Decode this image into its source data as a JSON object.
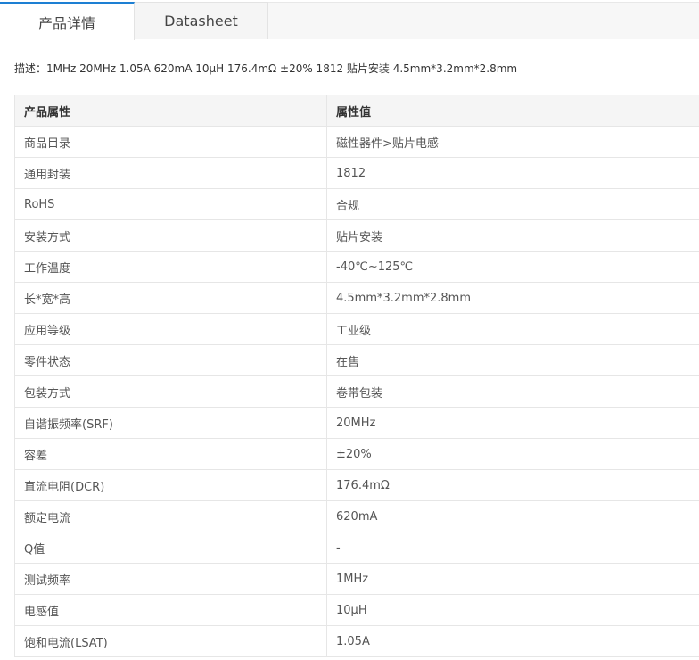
{
  "tabs": [
    {
      "label": "产品详情",
      "active": true
    },
    {
      "label": "Datasheet",
      "active": false
    }
  ],
  "description": "描述：1MHz 20MHz 1.05A 620mA 10μH 176.4mΩ ±20% 1812 贴片安装 4.5mm*3.2mm*2.8mm",
  "table": {
    "headers": [
      "产品属性",
      "属性值"
    ],
    "rows": [
      [
        "商品目录",
        "磁性器件>贴片电感"
      ],
      [
        "通用封装",
        "1812"
      ],
      [
        "RoHS",
        "合规"
      ],
      [
        "安装方式",
        "贴片安装"
      ],
      [
        "工作温度",
        "-40℃~125℃"
      ],
      [
        "长*宽*高",
        "4.5mm*3.2mm*2.8mm"
      ],
      [
        "应用等级",
        "工业级"
      ],
      [
        "零件状态",
        "在售"
      ],
      [
        "包装方式",
        "卷带包装"
      ],
      [
        "自谐振频率(SRF)",
        "20MHz"
      ],
      [
        "容差",
        "±20%"
      ],
      [
        "直流电阻(DCR)",
        "176.4mΩ"
      ],
      [
        "额定电流",
        "620mA"
      ],
      [
        "Q值",
        "-"
      ],
      [
        "测试频率",
        "1MHz"
      ],
      [
        "电感值",
        "10μH"
      ],
      [
        "饱和电流(LSAT)",
        "1.05A"
      ]
    ]
  },
  "colors": {
    "active_tab_accent": "#1d7fd3",
    "header_bg": "#f5f5f5",
    "border": "#e6e6e6"
  }
}
